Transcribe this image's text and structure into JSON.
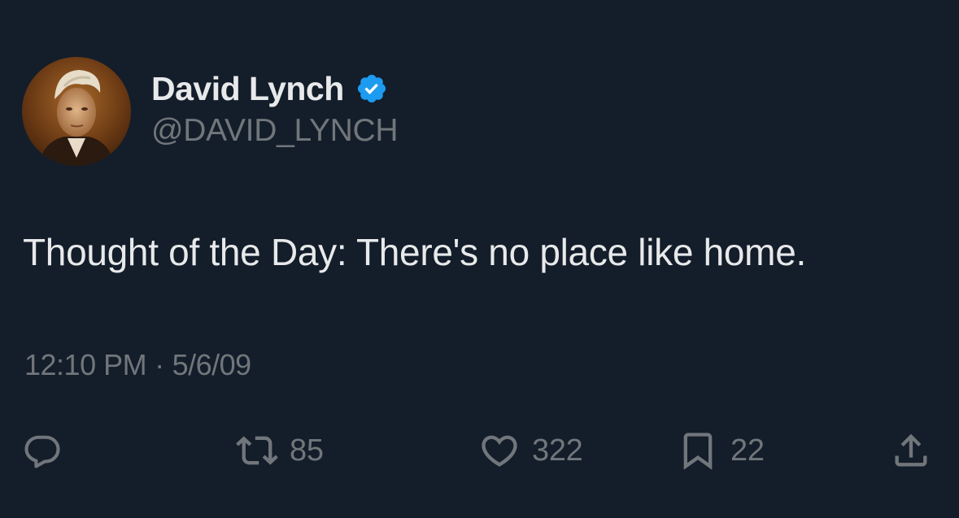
{
  "author": {
    "display_name": "David Lynch",
    "handle": "@DAVID_LYNCH",
    "verified": true,
    "verified_color": "#1d9bf0"
  },
  "tweet": {
    "text": "Thought of the Day: There's no place like home.",
    "time": "12:10 PM",
    "separator": "·",
    "date": "5/6/09"
  },
  "actions": {
    "reply_icon": "reply-icon",
    "retweet_icon": "retweet-icon",
    "retweets": "85",
    "like_icon": "heart-icon",
    "likes": "322",
    "bookmark_icon": "bookmark-icon",
    "bookmarks": "22",
    "share_icon": "share-icon"
  },
  "colors": {
    "background": "#141d2a",
    "primary_text": "#e7e9ea",
    "secondary_text": "#71767b"
  }
}
